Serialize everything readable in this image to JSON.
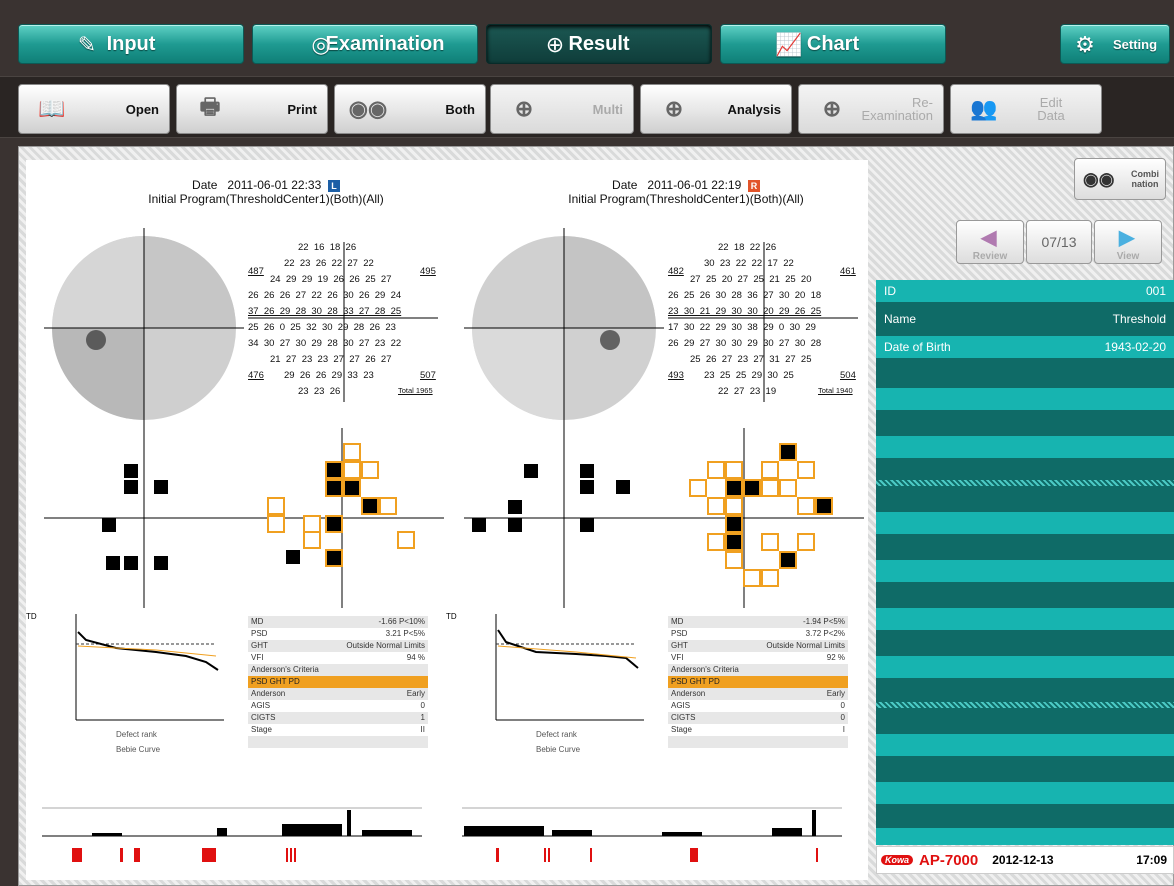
{
  "main_tabs": [
    {
      "label": "Input",
      "icon": "pen-icon"
    },
    {
      "label": "Examination",
      "icon": "target-icon"
    },
    {
      "label": "Result",
      "icon": "grid-icon"
    },
    {
      "label": "Chart",
      "icon": "chart-icon"
    }
  ],
  "setting_label": "Setting",
  "sub_tabs": [
    {
      "label": "Open"
    },
    {
      "label": "Print"
    },
    {
      "label": "Both"
    },
    {
      "label": "Multi"
    },
    {
      "label": "Analysis"
    },
    {
      "label": "Re-\nExamination"
    },
    {
      "label": "Edit\nData"
    }
  ],
  "left": {
    "date_label": "Date",
    "date": "2011-06-01 22:33",
    "eye": "L",
    "program": "Initial Program(ThresholdCenter1)(Both)(All)",
    "rows": [
      "22  16  18  26",
      "22  23  26  22  27  22",
      "24  29  29  19  26  26  25  27",
      "26  26  26  27  22  26  30  26  29  24",
      "37  26  29  28  30  28  33  27  28  25",
      "25  26  0  25  32  30  29  28  26  23",
      "34  30  27  30  29  28  30  27  23  22",
      "21  27  23  23  27  27  26  27",
      "29  26  26  29  33  23",
      "23  23  26"
    ],
    "quad": [
      "487",
      "495",
      "476",
      "507"
    ],
    "total": "Total 1965",
    "stats": [
      [
        "MD",
        "-1.66 P<10%"
      ],
      [
        "PSD",
        "3.21 P<5%"
      ],
      [
        "GHT",
        "Outside Normal Limits"
      ],
      [
        "VFI",
        "94 %"
      ],
      [
        "Anderson's Criteria",
        ""
      ],
      [
        "PSD    GHT    PD",
        ""
      ],
      [
        "Anderson",
        "Early"
      ],
      [
        "AGIS",
        "0"
      ],
      [
        "CIGTS",
        "1"
      ],
      [
        "Stage",
        "II"
      ],
      [
        "",
        ""
      ],
      [
        "",
        ""
      ]
    ],
    "curve_xlabel": "Defect rank",
    "curve_title": "Bebie Curve",
    "td": "TD"
  },
  "right": {
    "date_label": "Date",
    "date": "2011-06-01 22:19",
    "eye": "R",
    "program": "Initial Program(ThresholdCenter1)(Both)(All)",
    "rows": [
      "22  18  22  26",
      "30  23  22  22  17  22",
      "27  25  20  27  25  21  25  20",
      "26  25  26  30  28  36  27  30  20  18",
      "23  30  21  29  30  30  20  29  26  25",
      "17  30  22  29  30  38  29  0  30  29",
      "26  29  27  30  30  29  30  27  30  28",
      "25  26  27  23  27  31  27  25",
      "23  25  25  29  30  25",
      "22  27  23  19"
    ],
    "quad": [
      "482",
      "461",
      "493",
      "504"
    ],
    "total": "Total 1940",
    "stats": [
      [
        "MD",
        "-1.94 P<5%"
      ],
      [
        "PSD",
        "3.72 P<2%"
      ],
      [
        "GHT",
        "Outside Normal Limits"
      ],
      [
        "VFI",
        "92 %"
      ],
      [
        "Anderson's Criteria",
        ""
      ],
      [
        "PSD    GHT    PD",
        ""
      ],
      [
        "Anderson",
        "Early"
      ],
      [
        "AGIS",
        "0"
      ],
      [
        "CIGTS",
        "0"
      ],
      [
        "Stage",
        "I"
      ],
      [
        "",
        ""
      ],
      [
        "",
        ""
      ]
    ],
    "curve_xlabel": "Defect rank",
    "curve_title": "Bebie Curve",
    "td": "TD"
  },
  "side": {
    "combination_label": "Combi\nnation",
    "review_label": "Review",
    "view_label": "View",
    "page": "07/13",
    "id_label": "ID",
    "id_value": "001",
    "name_label": "Name",
    "name_value": "Threshold",
    "dob_label": "Date of Birth",
    "dob_value": "1943-02-20"
  },
  "footer": {
    "brand": "Kowa",
    "model": "AP-7000",
    "date": "2012-12-13",
    "time": "17:09"
  },
  "colors": {
    "teal": "#1f9b92",
    "stripe_a": "#17b4b0",
    "stripe_b": "#0f6b67",
    "orange": "#f0a020"
  }
}
